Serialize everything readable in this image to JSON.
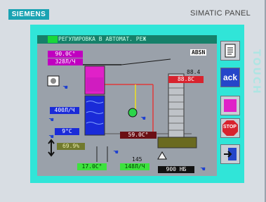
{
  "panel": {
    "brand": "SIEMENS",
    "model": "SIMATIC PANEL",
    "side_label": "TOUCH"
  },
  "screen": {
    "title": "РЕГУЛИРОВКА В АВТОМАТ. РЕЖ"
  },
  "logo": "ABSN",
  "readouts": {
    "top_temp": "90.0C°",
    "top_flow": "328Л/Ч",
    "flow_400": "400Л/Ч",
    "temp_9": "9°C",
    "percent": "69.9%",
    "mid_temp": "59.0C°",
    "small_145": "145",
    "bottom_temp": "17.0C°",
    "bottom_flow": "148Л/Ч",
    "tower_num": "88.4",
    "tower_temp": "88.8C",
    "weight": "900 НБ"
  },
  "buttons": {
    "ack": "ack",
    "stop": "STOP"
  },
  "colors": {
    "screen_bg": "#9aa1aa",
    "frame": "#30e5d8",
    "brand": "#1aa3b3",
    "magenta_tank": "#e021c8",
    "blue_tank": "#1a2bd8"
  }
}
